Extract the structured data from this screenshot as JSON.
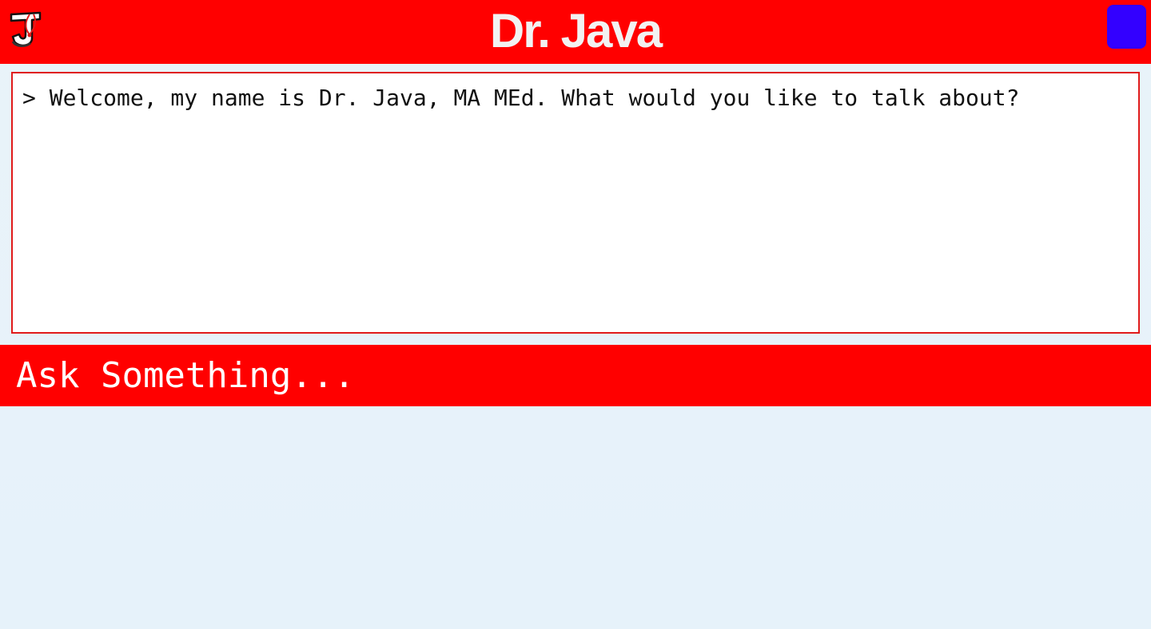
{
  "header": {
    "title": "Dr. Java",
    "logo_icon": "dr-java-j-logo-icon",
    "menu_button_color": "#3300ff",
    "background_color": "#ff0000"
  },
  "chat": {
    "messages": [
      {
        "prefix": ">",
        "text": "Welcome, my name is Dr. Java, MA MEd. What would you like to talk about?"
      }
    ],
    "border_color": "#e01b1b"
  },
  "ask": {
    "placeholder": "Ask Something...",
    "value": ""
  }
}
